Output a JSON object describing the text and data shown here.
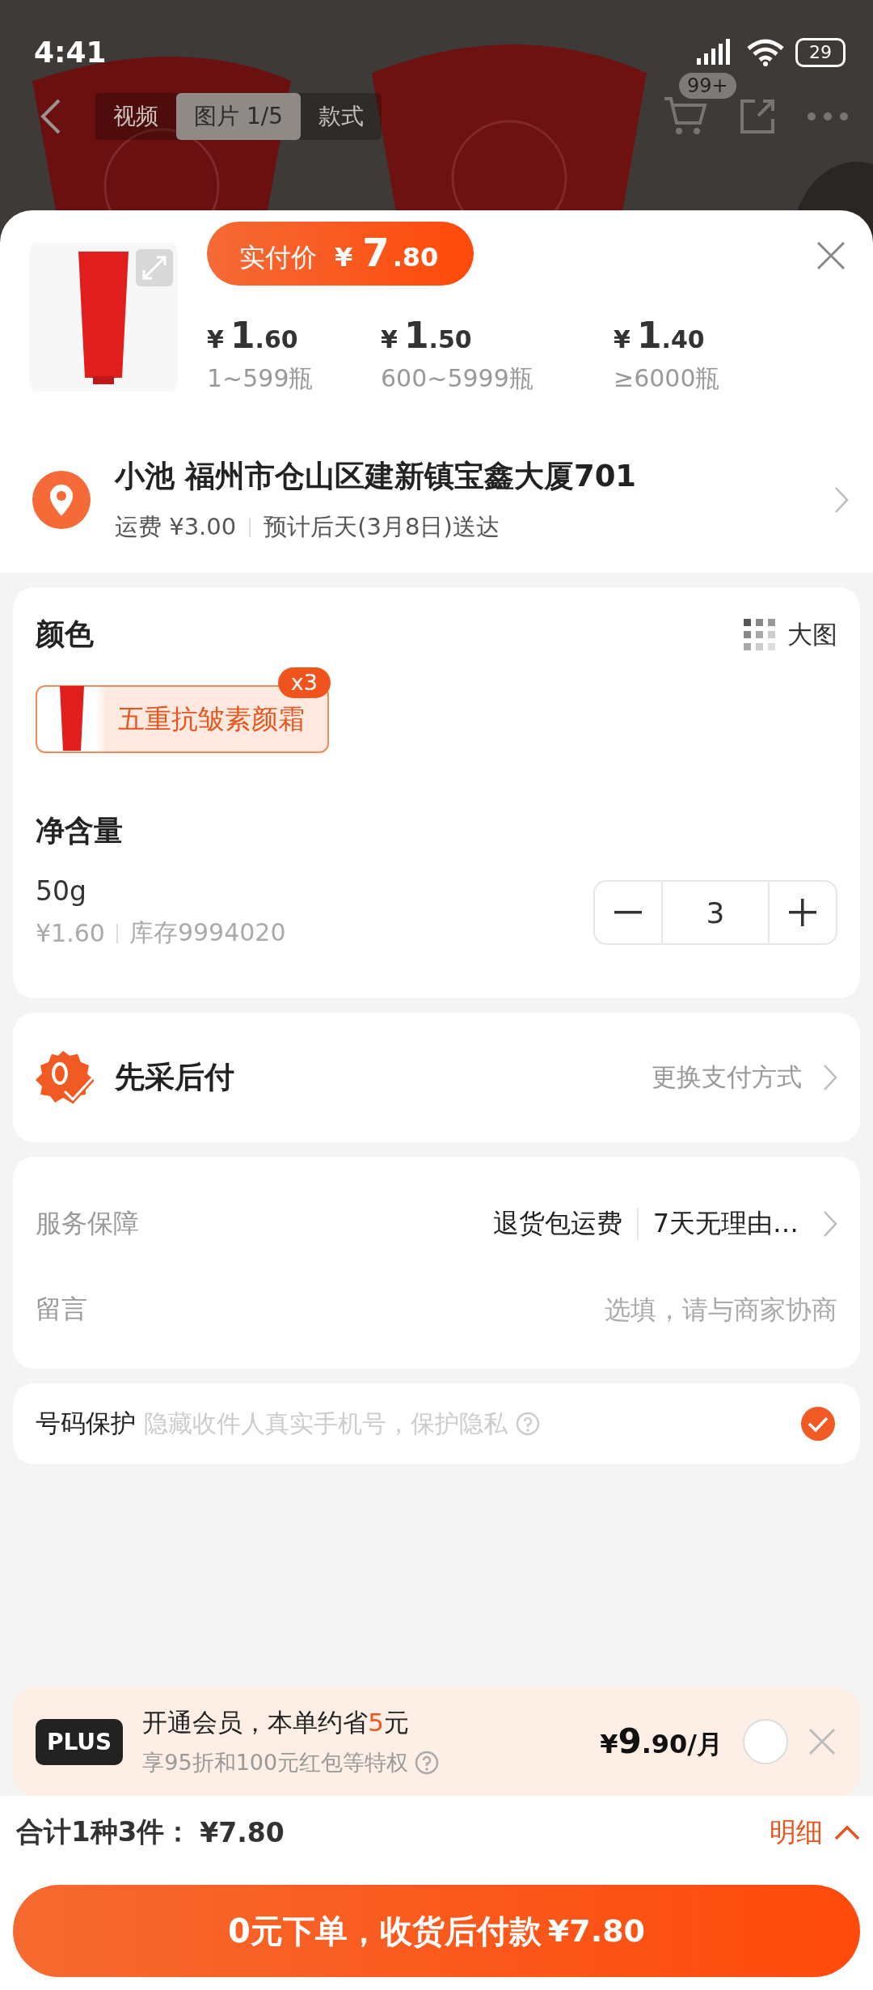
{
  "status_bar": {
    "time": "4:41",
    "battery": "29"
  },
  "gallery": {
    "tabs": [
      {
        "label": "视频",
        "selected": false
      },
      {
        "label": "图片 1/5",
        "selected": true
      },
      {
        "label": "款式",
        "selected": false
      }
    ],
    "cart_badge": "99+"
  },
  "product": {
    "actual_price": {
      "label": "实付价",
      "symbol": "¥",
      "whole": "7",
      "fraction": ".80"
    },
    "tiers": [
      {
        "symbol": "¥",
        "whole": "1",
        "fraction": ".60",
        "range": "1~599瓶"
      },
      {
        "symbol": "¥",
        "whole": "1",
        "fraction": ".50",
        "range": "600~5999瓶"
      },
      {
        "symbol": "¥",
        "whole": "1",
        "fraction": ".40",
        "range": "≥6000瓶"
      }
    ]
  },
  "address": {
    "line": "小池 福州市仓山区建新镇宝鑫大厦701",
    "shipping": "运费 ¥3.00",
    "delivery": "预计后天(3月8日)送达"
  },
  "color": {
    "title": "颜色",
    "view_toggle": "大图",
    "options": [
      {
        "label": "五重抗皱素颜霜",
        "count": "x3",
        "selected": true
      }
    ]
  },
  "size": {
    "title": "净含量",
    "name": "50g",
    "price": "¥1.60",
    "stock": "库存9994020",
    "quantity": "3"
  },
  "payment": {
    "title": "先采后付",
    "change": "更换支付方式"
  },
  "service": {
    "rows": [
      {
        "label": "服务保障",
        "kind": "tags",
        "tags": [
          "退货包运费",
          "7天无理由…"
        ]
      },
      {
        "label": "留言",
        "kind": "input",
        "placeholder": "选填，请与商家协商"
      }
    ]
  },
  "phone_protection": {
    "label": "号码保护",
    "note": "隐藏收件人真实手机号，保护隐私",
    "checked": true
  },
  "plus": {
    "badge": "PLUS",
    "title_before": "开通会员，本单约省",
    "savings": "5",
    "title_after": "元",
    "subtitle": "享95折和100元红包等特权",
    "symbol": "¥",
    "whole": "9",
    "fraction": ".90/月",
    "selected": false
  },
  "summary": {
    "label": "合计1种3件：",
    "amount": "¥7.80",
    "details": "明细"
  },
  "submit": {
    "label": "0元下单，收货后付款",
    "amount": "¥7.80"
  }
}
